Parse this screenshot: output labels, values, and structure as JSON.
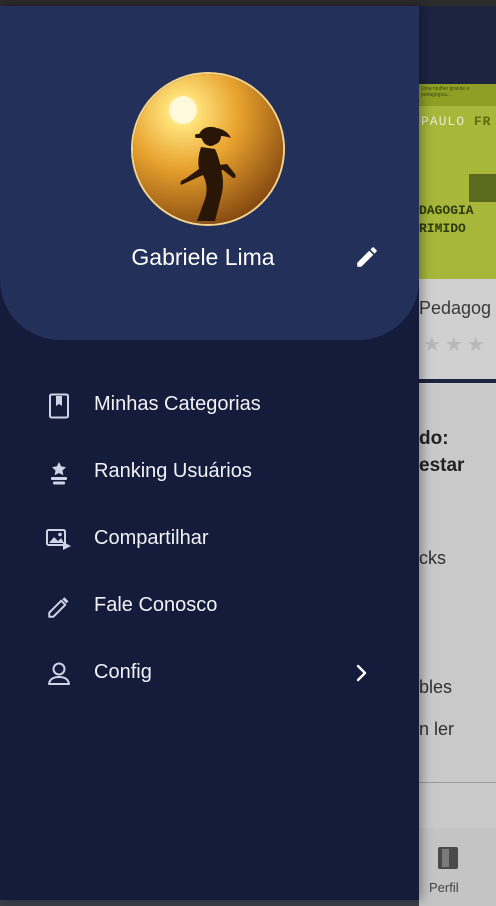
{
  "background_app": {
    "book": {
      "cover_small_text": "Uma mulher grande e pedagógica...",
      "author_part1": "PAULO ",
      "author_part2": "FR",
      "cover_title_line1": "DAGOGIA",
      "cover_title_line2": "RIMIDO",
      "title": "Pedagog",
      "rating_stars": "★★★",
      "cover_color": "#a7b73a"
    },
    "text_lines": [
      "do:",
      "estar",
      "cks",
      "bles",
      "n ler"
    ],
    "bottom_nav": {
      "label": "Perfil",
      "icon": "book-icon"
    }
  },
  "drawer": {
    "header_color": "#22305a",
    "background_color": "#151b3a",
    "profile": {
      "name": "Gabriele Lima",
      "avatar": "runner-silhouette-avatar",
      "edit_icon": "pencil-icon"
    },
    "menu_items": [
      {
        "label": "Minhas Categorias",
        "icon": "book-icon"
      },
      {
        "label": "Ranking Usuários",
        "icon": "ranking-icon"
      },
      {
        "label": "Compartilhar",
        "icon": "share-image-icon"
      },
      {
        "label": "Fale Conosco",
        "icon": "pencil-icon"
      },
      {
        "label": "Config",
        "icon": "user-settings-icon",
        "trailing_icon": "chevron-right-icon"
      }
    ]
  }
}
